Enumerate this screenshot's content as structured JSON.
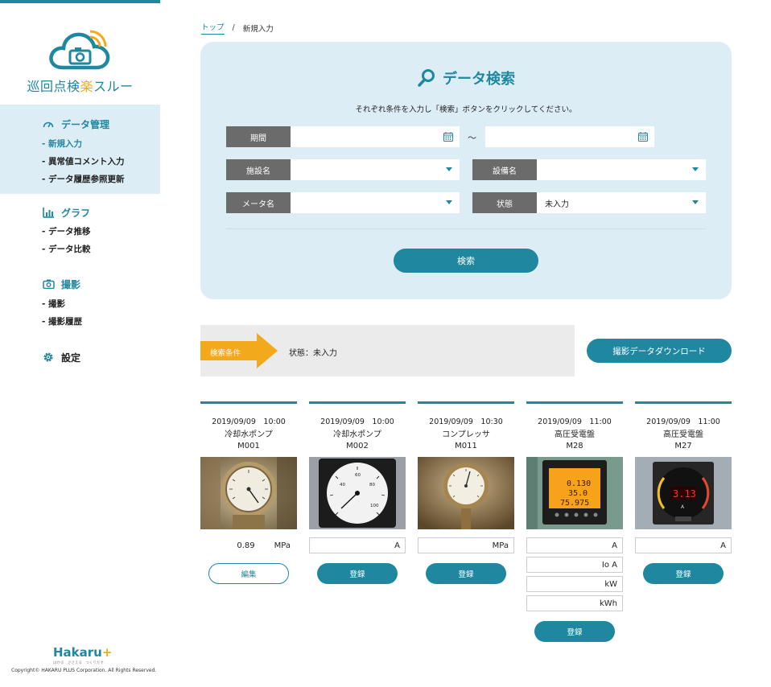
{
  "app": {
    "title_prefix": "巡回点検",
    "title_accent": "楽",
    "title_suffix": "スルー"
  },
  "sidebar": {
    "sections": [
      {
        "label": "データ管理",
        "icon": "gauge-icon",
        "items": [
          "- 新規入力",
          "- 異常値コメント入力",
          "- データ履歴参照更新"
        ]
      },
      {
        "label": "グラフ",
        "icon": "bar-chart-icon",
        "items": [
          "- データ推移",
          "- データ比較"
        ]
      },
      {
        "label": "撮影",
        "icon": "camera-icon",
        "items": [
          "- 撮影",
          "- 撮影履歴"
        ]
      },
      {
        "label": "設定",
        "icon": "gear-icon",
        "items": []
      }
    ],
    "footer_brand": "Hakaru",
    "footer_plus": "+",
    "footer_tagline": "はかる　ささえる　つくりだす",
    "copyright": "Copyright© HAKARU PLUS Corporation. All Rights Reserved."
  },
  "breadcrumb": {
    "home": "トップ",
    "separator": "/",
    "current": "新規入力"
  },
  "search": {
    "title": "データ検索",
    "description": "それぞれ条件を入力し「検索」ボタンをクリックしてください。",
    "period_label": "期間",
    "period_from": "",
    "period_to": "",
    "tilde": "～",
    "facility_label": "施設名",
    "facility_value": "",
    "equipment_label": "設備名",
    "equipment_value": "",
    "meter_label": "メータ名",
    "meter_value": "",
    "status_label": "状態",
    "status_value": "未入力",
    "button": "検索"
  },
  "conditions": {
    "tag": "検索条件",
    "text": "状態：未入力",
    "download_button": "撮影データダウンロード"
  },
  "cards": [
    {
      "date": "2019/09/09　10:00",
      "name": "冷却水ポンプ",
      "code": "M001",
      "value": "0.89",
      "units": [
        "MPa"
      ],
      "button": "編集"
    },
    {
      "date": "2019/09/09　10:00",
      "name": "冷却水ポンプ",
      "code": "M002",
      "units": [
        "A"
      ],
      "button": "登録"
    },
    {
      "date": "2019/09/09　10:30",
      "name": "コンプレッサ",
      "code": "M011",
      "units": [
        "MPa"
      ],
      "button": "登録"
    },
    {
      "date": "2019/09/09　11:00",
      "name": "高圧受電盤",
      "code": "M28",
      "units": [
        "A",
        "Io A",
        "kW",
        "kWh"
      ],
      "button": "登録"
    },
    {
      "date": "2019/09/09　11:00",
      "name": "高圧受電盤",
      "code": "M27",
      "units": [
        "A"
      ],
      "button": "登録"
    }
  ],
  "meter_displays": {
    "card4_line1": "0.130",
    "card4_line2": "35.0",
    "card4_line3": "75.975",
    "card5_display": "3.13",
    "card5_unit": "A"
  },
  "colors": {
    "brand": "#1f87a0",
    "accent": "#f2a91b",
    "panel_bg": "#dcedf6",
    "label_bg": "#6b6b6b"
  }
}
